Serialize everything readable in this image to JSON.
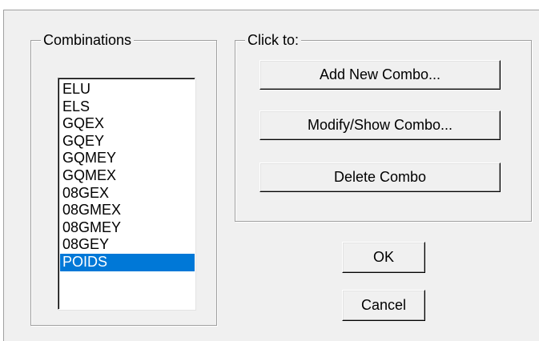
{
  "combinations": {
    "legend": "Combinations",
    "items": [
      "ELU",
      "ELS",
      "GQEX",
      "GQEY",
      "GQMEY",
      "GQMEX",
      "08GEX",
      "08GMEX",
      "08GMEY",
      "08GEY",
      "POIDS"
    ],
    "selected": "POIDS"
  },
  "click_to": {
    "legend": "Click to:",
    "add_label": "Add New Combo...",
    "modify_label": "Modify/Show Combo...",
    "delete_label": "Delete Combo"
  },
  "ok_label": "OK",
  "cancel_label": "Cancel",
  "colors": {
    "selection": "#0078d7",
    "dialog_bg": "#f0f0f0"
  }
}
